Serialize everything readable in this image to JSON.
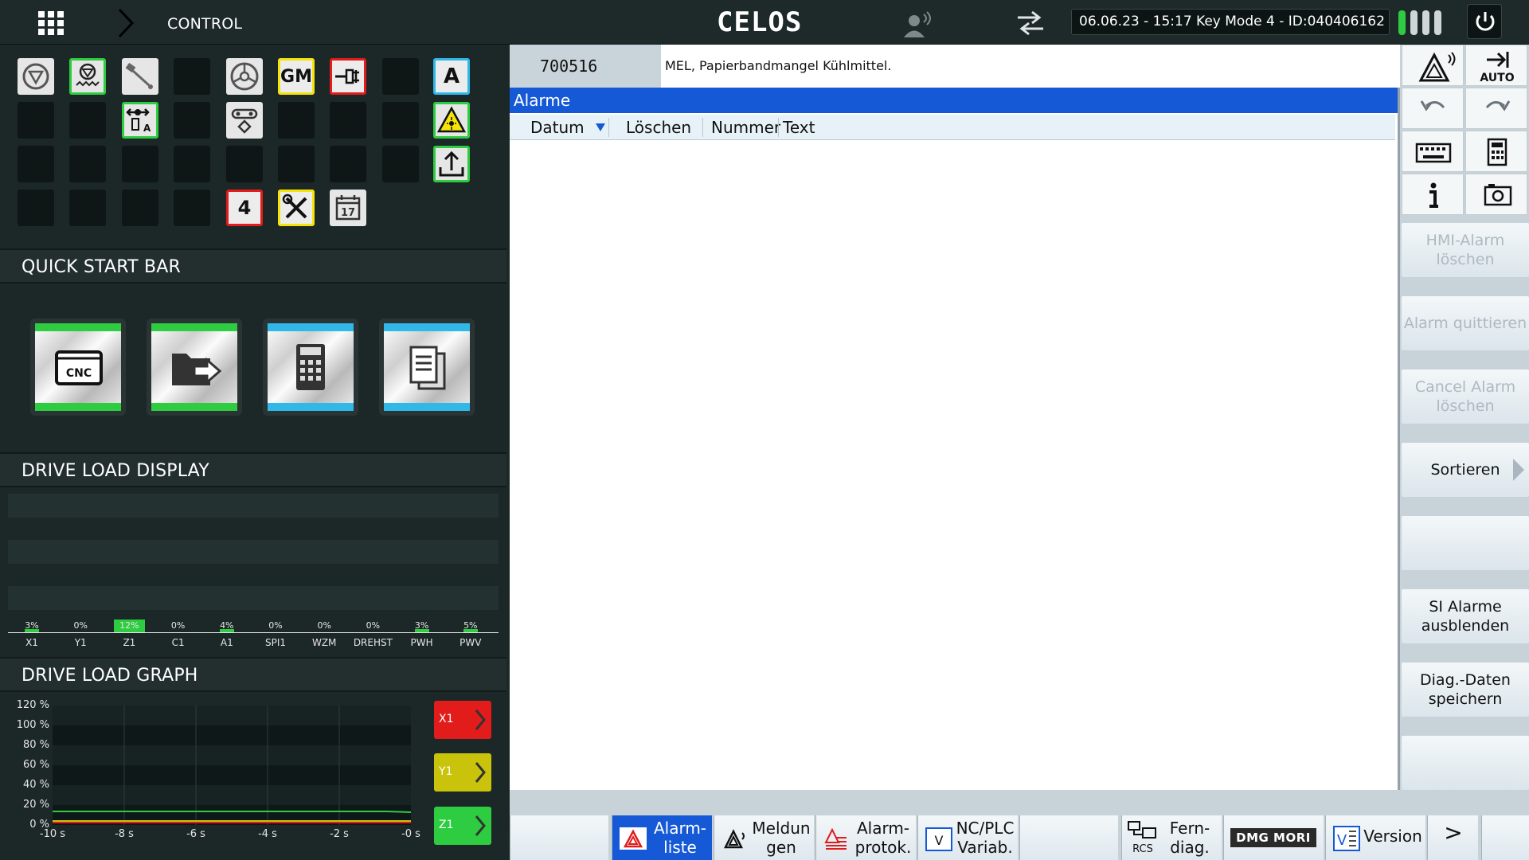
{
  "topbar": {
    "control_label": "CONTROL",
    "logo": "CELOS",
    "datetime": "06.06.23 - 15:17",
    "key_mode": "Key Mode 4",
    "machine_id": "ID:040406162",
    "info_text": "06.06.23 - 15:17   Key Mode 4 - ID:040406162",
    "battery_colors": [
      "#2ecc40",
      "#cfd6d6",
      "#cfd6d6",
      "#cfd6d6"
    ],
    "icons": [
      "app-grid-icon",
      "chevron-right-icon",
      "remote-user-icon",
      "swap-arrows-icon",
      "power-icon"
    ]
  },
  "status_icons": {
    "gm_label": "GM",
    "a_label": "A",
    "four_label": "4",
    "calendar_label": "17",
    "icons": [
      "emergency-stop-icon",
      "coolant-icon",
      "probe-icon",
      "spindle-icon",
      "gm-icon",
      "door-icon",
      "a-icon",
      "axis-arrows-icon",
      "laser-warning-icon",
      "tool-change-icon",
      "upload-icon",
      "four-icon",
      "tools-icon",
      "calendar-icon"
    ]
  },
  "quick_start": {
    "title": "QUICK START BAR",
    "cnc_label": "CNC",
    "items": [
      {
        "name": "cnc-app",
        "accent": "#2ecc40"
      },
      {
        "name": "file-manager-app",
        "accent": "#2ecc40"
      },
      {
        "name": "calculator-app",
        "accent": "#2fb8e8"
      },
      {
        "name": "documents-app",
        "accent": "#2fb8e8"
      }
    ]
  },
  "drive_load": {
    "title": "DRIVE LOAD DISPLAY",
    "axes": [
      {
        "name": "X1",
        "pct": "3%",
        "value": 3
      },
      {
        "name": "Y1",
        "pct": "0%",
        "value": 0
      },
      {
        "name": "Z1",
        "pct": "12%",
        "value": 12
      },
      {
        "name": "C1",
        "pct": "0%",
        "value": 0
      },
      {
        "name": "A1",
        "pct": "4%",
        "value": 4
      },
      {
        "name": "SPI1",
        "pct": "0%",
        "value": 0
      },
      {
        "name": "WZM",
        "pct": "0%",
        "value": 0
      },
      {
        "name": "DREHST",
        "pct": "0%",
        "value": 0
      },
      {
        "name": "PWH",
        "pct": "3%",
        "value": 3
      },
      {
        "name": "PWV",
        "pct": "5%",
        "value": 5
      }
    ]
  },
  "drive_graph": {
    "title": "DRIVE LOAD GRAPH",
    "y_ticks": [
      "120 %",
      "100 %",
      "80 %",
      "60 %",
      "40 %",
      "20 %",
      "0 %"
    ],
    "x_ticks": [
      "-10 s",
      "-8 s",
      "-6 s",
      "-4 s",
      "-2 s",
      "-0 s"
    ],
    "legend": [
      {
        "label": "X1",
        "color": "#e21b1b"
      },
      {
        "label": "Y1",
        "color": "#c9c30c"
      },
      {
        "label": "Z1",
        "color": "#2ecc40"
      }
    ]
  },
  "alarm": {
    "number": "700516",
    "message": "MEL, Papierbandmangel Kühlmittel.",
    "panel_title": "Alarme",
    "columns": [
      "Datum",
      "Löschen",
      "Nummer",
      "Text"
    ],
    "sort_icon": "sort-down-icon"
  },
  "sidebar": {
    "auto_label": "AUTO",
    "icons": [
      "alarm-triangle-icon",
      "auto-mode-icon",
      "undo-icon",
      "redo-icon",
      "keyboard-icon",
      "calculator-icon",
      "info-icon",
      "screenshot-icon"
    ],
    "buttons": [
      {
        "label": "HMI-Alarm löschen",
        "enabled": false
      },
      {
        "label": "Alarm quittieren",
        "enabled": false
      },
      {
        "label": "Cancel Alarm löschen",
        "enabled": false
      },
      {
        "label": "Sortieren",
        "enabled": true
      },
      {
        "label": "",
        "enabled": false
      },
      {
        "label": "SI Alarme ausblenden",
        "enabled": true
      },
      {
        "label": "Diag.-Daten speichern",
        "enabled": true
      },
      {
        "label": "",
        "enabled": false
      }
    ]
  },
  "softkeys": [
    {
      "label": "",
      "icon": ""
    },
    {
      "label": "Alarm- liste",
      "icon": "alarm-list-icon",
      "active": true
    },
    {
      "label": "Meldun gen",
      "icon": "messages-icon"
    },
    {
      "label": "Alarm- protok.",
      "icon": "alarm-log-icon"
    },
    {
      "label": "NC/PLC Variab.",
      "icon": "variables-icon",
      "icon_text": "V"
    },
    {
      "label": "",
      "icon": ""
    },
    {
      "label": "Fern- diag.",
      "icon": "remote-diag-icon",
      "icon_text": "RCS"
    },
    {
      "label": "DMG MORI",
      "icon": "dmg-mori-logo"
    },
    {
      "label": "Version",
      "icon": "version-icon",
      "icon_text": "V"
    },
    {
      "label": ">",
      "icon": "next-icon"
    }
  ]
}
